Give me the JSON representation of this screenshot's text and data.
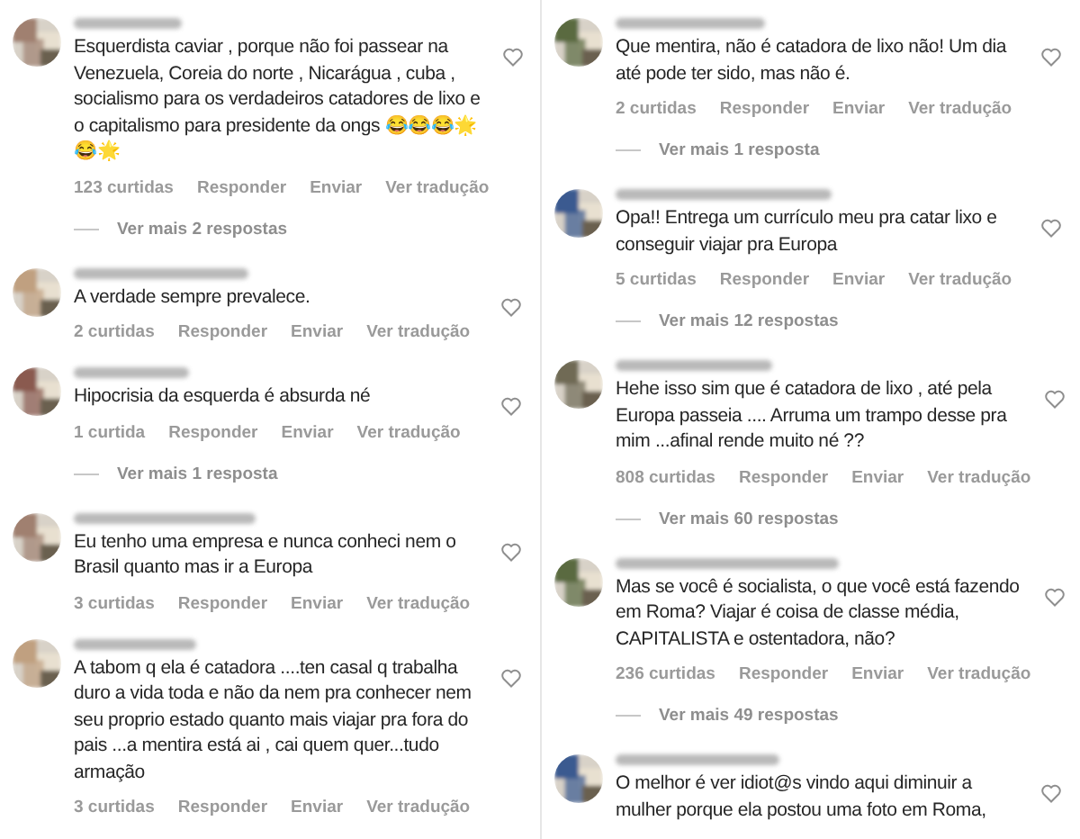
{
  "columns": [
    {
      "comments": [
        {
          "text": "Esquerdista caviar , porque não foi passear na Venezuela, Coreia do norte , Nicarágua , cuba , socialismo para os verdadeiros catadores de lixo e o capitalismo para presidente da ongs 😂😂😂🌟😂🌟",
          "likes": "123 curtidas",
          "actions": [
            "Responder",
            "Enviar",
            "Ver tradução"
          ],
          "replies": "Ver mais 2 respostas"
        },
        {
          "text": "A verdade sempre prevalece.",
          "likes": "2 curtidas",
          "actions": [
            "Responder",
            "Enviar",
            "Ver tradução"
          ]
        },
        {
          "text": "Hipocrisia da esquerda é absurda né",
          "likes": "1 curtida",
          "actions": [
            "Responder",
            "Enviar",
            "Ver tradução"
          ],
          "replies": "Ver mais 1 resposta"
        },
        {
          "text": "Eu tenho uma empresa e nunca conheci nem o Brasil quanto mas ir a Europa",
          "likes": "3 curtidas",
          "actions": [
            "Responder",
            "Enviar",
            "Ver tradução"
          ]
        },
        {
          "text": "A tabom q ela é catadora ....ten casal q trabalha duro a vida toda e não da nem pra conhecer nem seu proprio estado quanto mais viajar pra fora do pais ...a mentira está ai , cai quem quer...tudo armação",
          "likes": "3 curtidas",
          "actions": [
            "Responder",
            "Enviar",
            "Ver tradução"
          ]
        }
      ]
    },
    {
      "comments": [
        {
          "text": "Que mentira, não é catadora de lixo não! Um dia até pode ter sido, mas não é.",
          "likes": "2 curtidas",
          "actions": [
            "Responder",
            "Enviar",
            "Ver tradução"
          ],
          "replies": "Ver mais 1 resposta"
        },
        {
          "text": "Opa!! Entrega um currículo meu pra catar lixo e conseguir viajar pra Europa",
          "likes": "5 curtidas",
          "actions": [
            "Responder",
            "Enviar",
            "Ver tradução"
          ],
          "replies": "Ver mais 12 respostas"
        },
        {
          "text": "Hehe isso sim que é catadora de lixo , até pela Europa passeia .... Arruma um trampo desse pra mim ...afinal rende muito né ??",
          "likes": "808 curtidas",
          "actions": [
            "Responder",
            "Enviar",
            "Ver tradução"
          ],
          "replies": "Ver mais 60 respostas"
        },
        {
          "text": "Mas se você é socialista, o que você está fazendo em Roma? Viajar é coisa de classe média, CAPITALISTA e ostentadora, não?",
          "likes": "236 curtidas",
          "actions": [
            "Responder",
            "Enviar",
            "Ver tradução"
          ],
          "replies": "Ver mais 49 respostas"
        },
        {
          "text": "O melhor é ver idiot@s vindo aqui diminuir a mulher porque ela postou uma foto em Roma,"
        }
      ]
    }
  ]
}
